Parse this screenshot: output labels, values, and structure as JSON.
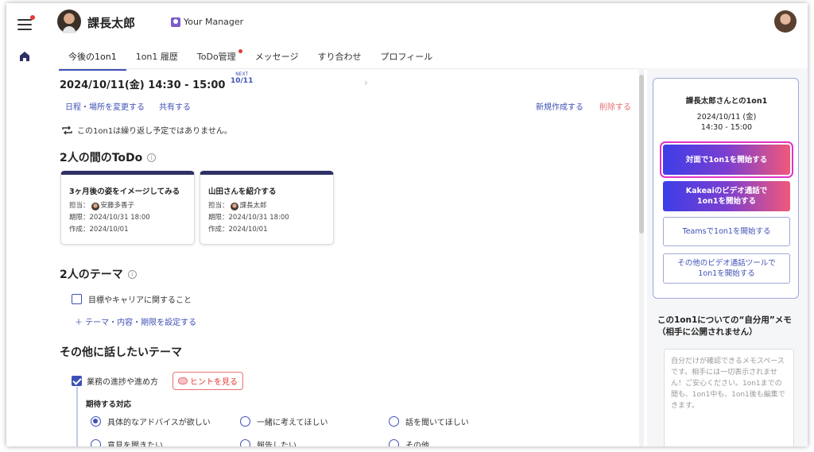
{
  "header": {
    "manager_name": "課長太郎",
    "badge_label": "Your Manager"
  },
  "tabs": [
    {
      "label": "今後の1on1",
      "active": true
    },
    {
      "label": "1on1 履歴"
    },
    {
      "label": "ToDo管理",
      "has_dot": true
    },
    {
      "label": "メッセージ"
    },
    {
      "label": "すり合わせ"
    },
    {
      "label": "プロフィール"
    }
  ],
  "session": {
    "date_time": "2024/10/11(金)  14:30 - 15:00",
    "next_label": "NEXT",
    "next_date": "10/11",
    "change_link": "日程・場所を変更する",
    "share_link": "共有する",
    "new_link": "新規作成する",
    "delete_link": "削除する",
    "repeat_note": "この1on1は繰り返し予定ではありません。"
  },
  "todo_section": {
    "title": "2人の間のToDo",
    "cards": [
      {
        "title": "3ヶ月後の姿をイメージしてみる",
        "assignee_label": "担当：",
        "assignee": "安藤多香子",
        "deadline": "期限：2024/10/31 18:00",
        "created": "作成：2024/10/01"
      },
      {
        "title": "山田さんを紹介する",
        "assignee_label": "担当：",
        "assignee": "課長太郎",
        "deadline": "期限：2024/10/31 18:00",
        "created": "作成：2024/10/01"
      }
    ]
  },
  "theme_section": {
    "title": "2人のテーマ",
    "item": "目標やキャリアに関すること",
    "add_link": "＋  テーマ・内容・期限を設定する"
  },
  "other_section": {
    "title": "その他に話したいテーマ",
    "item": "業務の進捗や進め方",
    "hint_button": "ヒントを見る",
    "expect_label": "期待する対応",
    "options": [
      {
        "label": "具体的なアドバイスが欲しい",
        "checked": true
      },
      {
        "label": "一緒に考えてほしい"
      },
      {
        "label": "話を聞いてほしい"
      },
      {
        "label": "意見を聞きたい"
      },
      {
        "label": "報告したい"
      },
      {
        "label": "その他"
      }
    ]
  },
  "side_panel": {
    "title": "課長太郎さんとの1on1",
    "date": "2024/10/11 (金)",
    "time": "14:30 - 15:00",
    "btn_face": "対面で1on1を開始する",
    "btn_kakeai_1": "Kakeaiのビデオ通話で",
    "btn_kakeai_2": "1on1を開始する",
    "btn_teams": "Teamsで1on1を開始する",
    "btn_other_1": "その他のビデオ通話ツールで",
    "btn_other_2": "1on1を開始する",
    "memo_title_1": "この1on1についての“自分用”メモ",
    "memo_title_2": "（相手に公開されません）",
    "memo_placeholder": "自分だけが確認できるメモスペースです。相手には一切表示されません！ご安心ください。1on1までの間も、1on1中も、1on1後も編集できます。"
  },
  "colors": {
    "accent": "#3f51b5",
    "danger": "#e57373",
    "highlight": "#e033c6",
    "card_top": "#2e3166"
  }
}
